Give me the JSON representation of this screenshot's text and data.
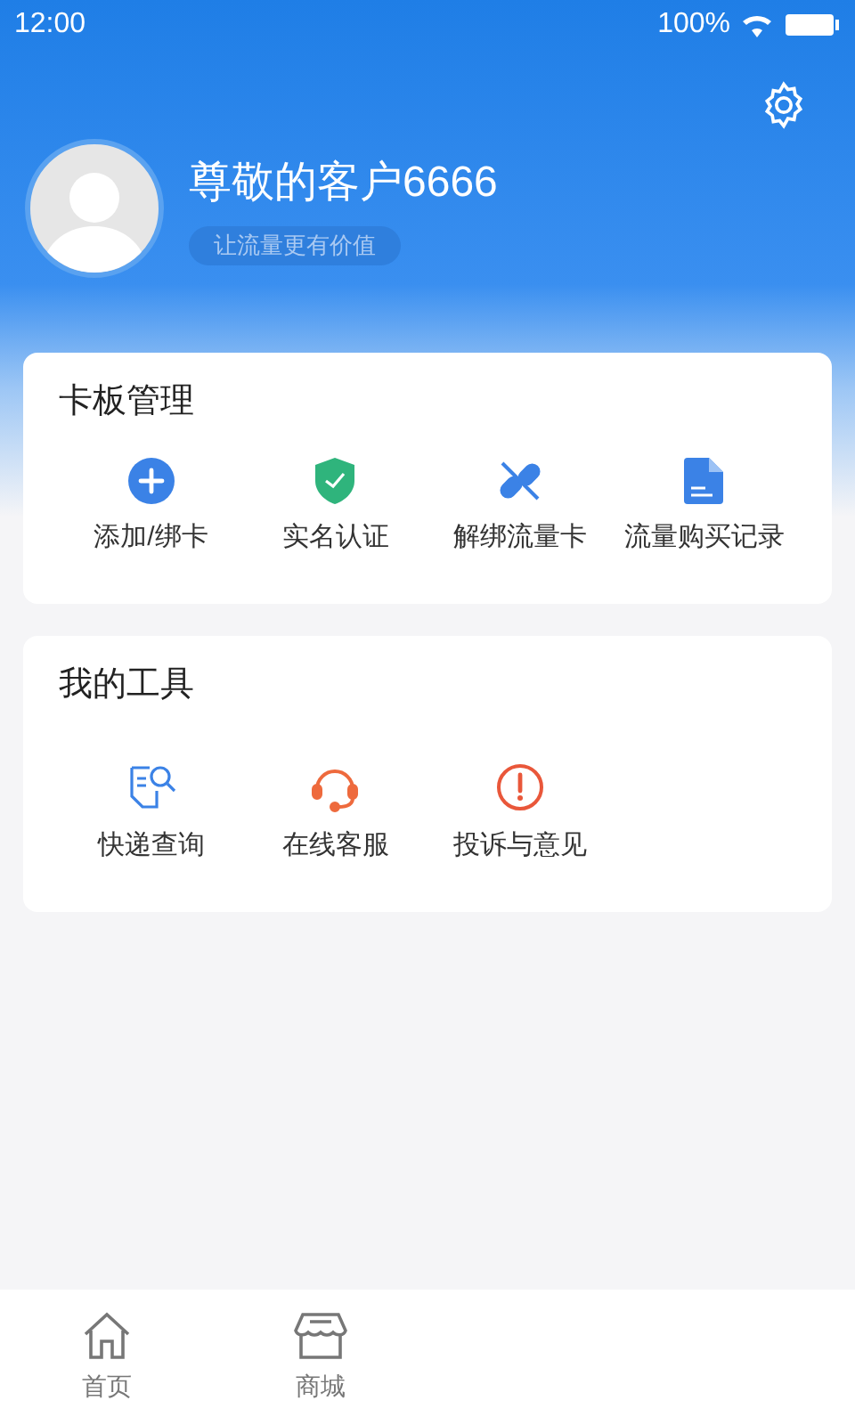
{
  "status_bar": {
    "time": "12:00",
    "battery": "100%"
  },
  "profile": {
    "name": "尊敬的客户6666",
    "slogan": "让流量更有价值"
  },
  "sections": [
    {
      "title": "卡板管理",
      "items": [
        {
          "label": "添加/绑卡",
          "kind": "add"
        },
        {
          "label": "实名认证",
          "kind": "shield"
        },
        {
          "label": "解绑流量卡",
          "kind": "unlink"
        },
        {
          "label": "流量购买记录",
          "kind": "document"
        }
      ]
    },
    {
      "title": "我的工具",
      "items": [
        {
          "label": "快递查询",
          "kind": "search-doc"
        },
        {
          "label": "在线客服",
          "kind": "headset"
        },
        {
          "label": "投诉与意见",
          "kind": "alert"
        }
      ]
    }
  ],
  "tab_bar": [
    {
      "label": "首页",
      "kind": "home"
    },
    {
      "label": "商城",
      "kind": "store"
    }
  ]
}
